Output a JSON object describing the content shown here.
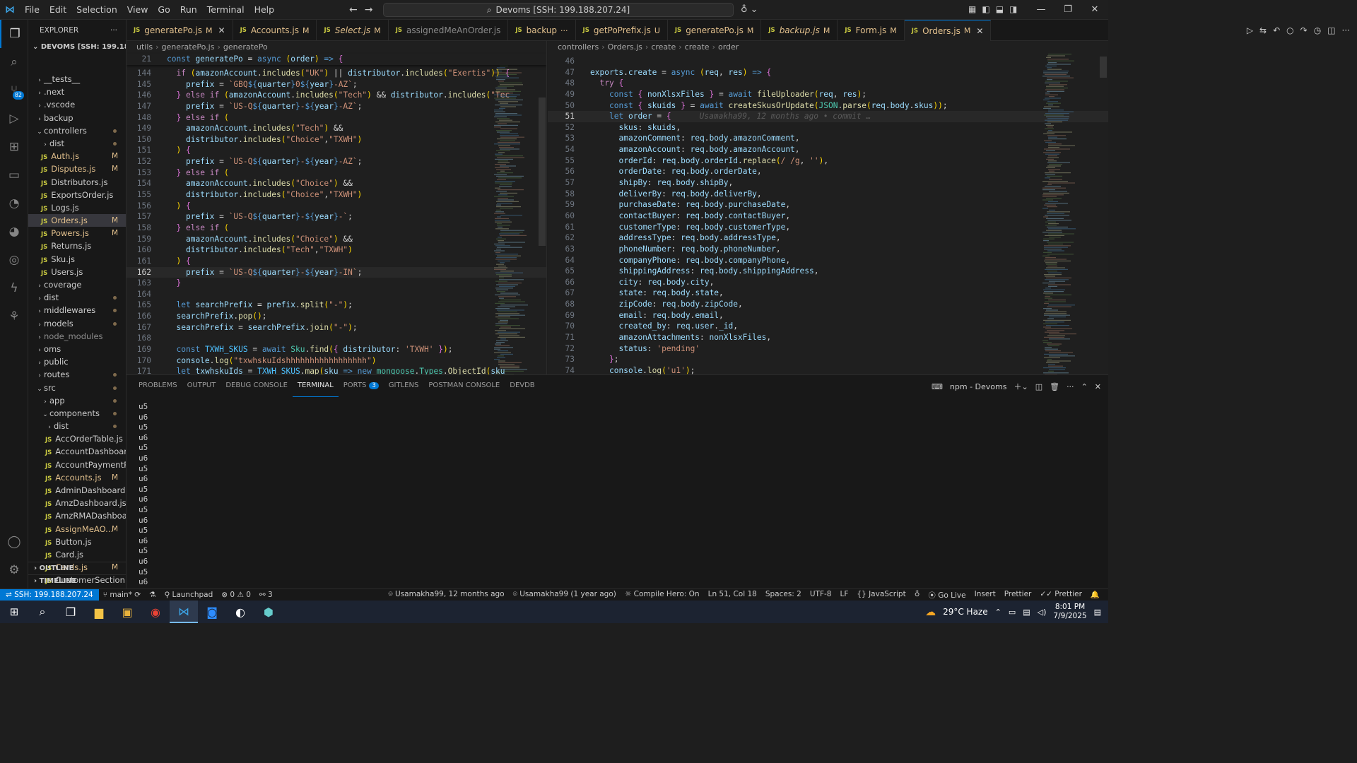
{
  "titlebar": {
    "menu": [
      "File",
      "Edit",
      "Selection",
      "View",
      "Go",
      "Run",
      "Terminal",
      "Help"
    ],
    "search_text": "Devoms [SSH: 199.188.207.24]"
  },
  "activity_badges": {
    "source_control": "82"
  },
  "explorer": {
    "title": "EXPLORER",
    "root": "DEVOMS [SSH: 199.188.20...",
    "items": [
      {
        "label": "__tests__",
        "type": "folder",
        "depth": 1,
        "open": false
      },
      {
        "label": ".next",
        "type": "folder",
        "depth": 1,
        "open": false
      },
      {
        "label": ".vscode",
        "type": "folder",
        "depth": 1,
        "open": false
      },
      {
        "label": "backup",
        "type": "folder",
        "depth": 1,
        "open": false
      },
      {
        "label": "controllers",
        "type": "folder",
        "depth": 1,
        "open": true,
        "dot": true
      },
      {
        "label": "dist",
        "type": "folder",
        "depth": 2,
        "open": false,
        "dot": true
      },
      {
        "label": "Auth.js",
        "type": "js",
        "depth": 2,
        "status": "M"
      },
      {
        "label": "Disputes.js",
        "type": "js",
        "depth": 2,
        "status": "M"
      },
      {
        "label": "Distributors.js",
        "type": "js",
        "depth": 2
      },
      {
        "label": "ExportsOrder.js",
        "type": "js",
        "depth": 2
      },
      {
        "label": "Logs.js",
        "type": "js",
        "depth": 2
      },
      {
        "label": "Orders.js",
        "type": "js",
        "depth": 2,
        "status": "M",
        "selected": true
      },
      {
        "label": "Powers.js",
        "type": "js",
        "depth": 2,
        "status": "M"
      },
      {
        "label": "Returns.js",
        "type": "js",
        "depth": 2
      },
      {
        "label": "Sku.js",
        "type": "js",
        "depth": 2
      },
      {
        "label": "Users.js",
        "type": "js",
        "depth": 2
      },
      {
        "label": "coverage",
        "type": "folder",
        "depth": 1,
        "open": false
      },
      {
        "label": "dist",
        "type": "folder",
        "depth": 1,
        "open": false,
        "dot": true
      },
      {
        "label": "middlewares",
        "type": "folder",
        "depth": 1,
        "open": false,
        "dot": true
      },
      {
        "label": "models",
        "type": "folder",
        "depth": 1,
        "open": false,
        "dot": true
      },
      {
        "label": "node_modules",
        "type": "folder",
        "depth": 1,
        "open": false,
        "dim": true
      },
      {
        "label": "oms",
        "type": "folder",
        "depth": 1,
        "open": false
      },
      {
        "label": "public",
        "type": "folder",
        "depth": 1,
        "open": false
      },
      {
        "label": "routes",
        "type": "folder",
        "depth": 1,
        "open": false,
        "dot": true
      },
      {
        "label": "src",
        "type": "folder",
        "depth": 1,
        "open": true,
        "dot": true
      },
      {
        "label": "app",
        "type": "folder",
        "depth": 2,
        "open": false,
        "dot": true
      },
      {
        "label": "components",
        "type": "folder",
        "depth": 2,
        "open": true,
        "dot": true
      },
      {
        "label": "dist",
        "type": "folder",
        "depth": 3,
        "open": false,
        "dot": true
      },
      {
        "label": "AccOrderTable.js",
        "type": "js",
        "depth": 3
      },
      {
        "label": "AccountDashboar...",
        "type": "js",
        "depth": 3
      },
      {
        "label": "AccountPaymentP...",
        "type": "js",
        "depth": 3
      },
      {
        "label": "Accounts.js",
        "type": "js",
        "depth": 3,
        "status": "M"
      },
      {
        "label": "AdminDashboard.js",
        "type": "js",
        "depth": 3
      },
      {
        "label": "AmzDashboard.js",
        "type": "js",
        "depth": 3
      },
      {
        "label": "AmzRMADashboar...",
        "type": "js",
        "depth": 3
      },
      {
        "label": "AssignMeAO...",
        "type": "js",
        "depth": 3,
        "status": "M"
      },
      {
        "label": "Button.js",
        "type": "js",
        "depth": 3
      },
      {
        "label": "Card.js",
        "type": "js",
        "depth": 3
      },
      {
        "label": "Cards.js",
        "type": "js",
        "depth": 3,
        "status": "M"
      },
      {
        "label": "CustomerSection.js",
        "type": "js",
        "depth": 3
      }
    ],
    "outline": "OUTLINE",
    "timeline": "TIMELINE"
  },
  "tabs": [
    {
      "label": "generatePo.js",
      "status": "M",
      "mod": true,
      "close": true
    },
    {
      "label": "Accounts.js",
      "status": "M",
      "mod": true
    },
    {
      "label": "Select.js",
      "status": "M",
      "mod": true,
      "italic": true
    },
    {
      "label": "assignedMeAnOrder.js",
      "dim": true
    },
    {
      "label": "backup",
      "status": "···",
      "mod": true
    },
    {
      "label": "getPoPrefix.js",
      "status": "U",
      "mod": true
    },
    {
      "label": "generatePo.js",
      "status": "M",
      "mod": true
    },
    {
      "label": "backup.js",
      "status": "M",
      "mod": true,
      "italic": true
    },
    {
      "label": "Form.js",
      "status": "M",
      "mod": true
    },
    {
      "label": "Orders.js",
      "status": "M",
      "mod": true,
      "active": true,
      "close": true
    }
  ],
  "left_editor": {
    "breadcrumb": [
      "utils",
      "generatePo.js",
      "generatePo"
    ],
    "sticky": {
      "num": "21",
      "code": "const generatePo = async (order) => {"
    },
    "lines": [
      {
        "num": "144",
        "code": "  if (amazonAccount.includes(\"UK\") || distributor.includes(\"Exertis\")) {"
      },
      {
        "num": "145",
        "code": "    prefix = `GBQ${quarter}0${year}-AZ`;"
      },
      {
        "num": "146",
        "code": "  } else if (amazonAccount.includes(\"Tech\") && distributor.includes(\"Tec"
      },
      {
        "num": "147",
        "code": "    prefix = `US-Q${quarter}-${year}-AZ`;"
      },
      {
        "num": "148",
        "code": "  } else if ("
      },
      {
        "num": "149",
        "code": "    amazonAccount.includes(\"Tech\") &&"
      },
      {
        "num": "150",
        "code": "    distributor.includes(\"Choice\",\"TXWH\")"
      },
      {
        "num": "151",
        "code": "  ) {"
      },
      {
        "num": "152",
        "code": "    prefix = `US-Q${quarter}-${year}-AZ`;"
      },
      {
        "num": "153",
        "code": "  } else if ("
      },
      {
        "num": "154",
        "code": "    amazonAccount.includes(\"Choice\") &&"
      },
      {
        "num": "155",
        "code": "    distributor.includes(\"Choice\",\"TXWH\")"
      },
      {
        "num": "156",
        "code": "  ) {"
      },
      {
        "num": "157",
        "code": "    prefix = `US-Q${quarter}-${year}-`;"
      },
      {
        "num": "158",
        "code": "  } else if ("
      },
      {
        "num": "159",
        "code": "    amazonAccount.includes(\"Choice\") &&"
      },
      {
        "num": "160",
        "code": "    distributor.includes(\"Tech\",\"TXWH\")"
      },
      {
        "num": "161",
        "code": "  ) {"
      },
      {
        "num": "162",
        "code": "    prefix = `US-Q${quarter}-${year}-IN`;",
        "current": true
      },
      {
        "num": "163",
        "code": "  }"
      },
      {
        "num": "164",
        "code": ""
      },
      {
        "num": "165",
        "code": "  let searchPrefix = prefix.split(\"-\");"
      },
      {
        "num": "166",
        "code": "  searchPrefix.pop();"
      },
      {
        "num": "167",
        "code": "  searchPrefix = searchPrefix.join(\"-\");"
      },
      {
        "num": "168",
        "code": ""
      },
      {
        "num": "169",
        "code": "  const TXWH_SKUS = await Sku.find({ distributor: 'TXWH' });"
      },
      {
        "num": "170",
        "code": "  console.log(\"txwhskuIdshhhhhhhhhhhhhhhhh\")"
      },
      {
        "num": "171",
        "code": "  let txwhskuIds = TXWH_SKUS.map(sku => new mongoose.Types.ObjectId(sku"
      }
    ]
  },
  "right_editor": {
    "breadcrumb": [
      "controllers",
      "Orders.js",
      "create",
      "create",
      "order"
    ],
    "lines": [
      {
        "num": "46",
        "code": ""
      },
      {
        "num": "47",
        "code": "exports.create = async (req, res) => {"
      },
      {
        "num": "48",
        "code": "  try {"
      },
      {
        "num": "49",
        "code": "    const { nonXlsxFiles } = await fileUploader(req, res);"
      },
      {
        "num": "50",
        "code": "    const { skuids } = await createSkusOrUpdate(JSON.parse(req.body.skus));"
      },
      {
        "num": "51",
        "code": "    let order = {",
        "current": true,
        "blame": "Usamakha99, 12 months ago • commit …"
      },
      {
        "num": "52",
        "code": "      skus: skuids,"
      },
      {
        "num": "53",
        "code": "      amazonComment: req.body.amazonComment,"
      },
      {
        "num": "54",
        "code": "      amazonAccount: req.body.amazonAccount,"
      },
      {
        "num": "55",
        "code": "      orderId: req.body.orderId.replace(/ /g, ''),"
      },
      {
        "num": "56",
        "code": "      orderDate: req.body.orderDate,"
      },
      {
        "num": "57",
        "code": "      shipBy: req.body.shipBy,"
      },
      {
        "num": "58",
        "code": "      deliverBy: req.body.deliverBy,"
      },
      {
        "num": "59",
        "code": "      purchaseDate: req.body.purchaseDate,"
      },
      {
        "num": "60",
        "code": "      contactBuyer: req.body.contactBuyer,"
      },
      {
        "num": "61",
        "code": "      customerType: req.body.customerType,"
      },
      {
        "num": "62",
        "code": "      addressType: req.body.addressType,"
      },
      {
        "num": "63",
        "code": "      phoneNumber: req.body.phoneNumber,"
      },
      {
        "num": "64",
        "code": "      companyPhone: req.body.companyPhone,"
      },
      {
        "num": "65",
        "code": "      shippingAddress: req.body.shippingAddress,"
      },
      {
        "num": "66",
        "code": "      city: req.body.city,"
      },
      {
        "num": "67",
        "code": "      state: req.body.state,"
      },
      {
        "num": "68",
        "code": "      zipCode: req.body.zipCode,"
      },
      {
        "num": "69",
        "code": "      email: req.body.email,"
      },
      {
        "num": "70",
        "code": "      created_by: req.user._id,"
      },
      {
        "num": "71",
        "code": "      amazonAttachments: nonXlsxFiles,"
      },
      {
        "num": "72",
        "code": "      status: 'pending'"
      },
      {
        "num": "73",
        "code": "    };"
      },
      {
        "num": "74",
        "code": "    console.log('u1');"
      }
    ]
  },
  "panel": {
    "tabs": [
      "PROBLEMS",
      "OUTPUT",
      "DEBUG CONSOLE",
      "TERMINAL",
      "PORTS",
      "GITLENS",
      "POSTMAN CONSOLE",
      "DEVDB"
    ],
    "active_tab": "TERMINAL",
    "ports_badge": "3",
    "terminal_name": "npm - Devoms",
    "terminal_lines": [
      "u5",
      "u6",
      "u5",
      "u6",
      "u5",
      "u6",
      "u5",
      "u6",
      "u5",
      "u6",
      "u5",
      "u6",
      "u5",
      "u6",
      "u5",
      "u6",
      "u5",
      "u6"
    ]
  },
  "statusbar": {
    "remote": "SSH: 199.188.207.24",
    "branch": "main*",
    "launchpad": "Launchpad",
    "errors": "0",
    "warnings": "0",
    "ports": "3",
    "blame_line": "Usamakha99, 12 months ago",
    "blame_file": "Usamakha99 (1 year ago)",
    "compile_hero": "Compile Hero: On",
    "position": "Ln 51, Col 18",
    "spaces": "Spaces: 2",
    "encoding": "UTF-8",
    "eol": "LF",
    "language": "JavaScript",
    "golive": "Go Live",
    "insert": "Insert",
    "prettier1": "Prettier",
    "prettier2": "Prettier"
  },
  "taskbar": {
    "weather": "29°C  Haze",
    "time": "8:01 PM",
    "date": "7/9/2025"
  }
}
